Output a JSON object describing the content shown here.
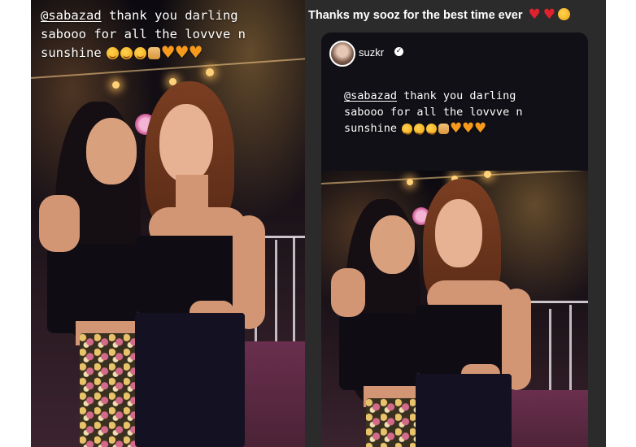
{
  "left_story": {
    "mention": "@sabazad",
    "line1_rest": " thank you darling",
    "line2": "sabooo for all the lovvve n",
    "line3": "sunshine",
    "emojis": [
      "smiling-face-with-hearts",
      "smiling-face-with-hearts",
      "smiling-face-with-hearts",
      "raising-hands",
      "orange-heart",
      "orange-heart",
      "orange-heart"
    ]
  },
  "right_post": {
    "caption": "Thanks my sooz for the best time ever",
    "caption_emojis": [
      "red-heart",
      "red-heart",
      "smiling-face-with-hearts"
    ],
    "shared_story": {
      "username": "suzkr",
      "verified": true,
      "mention": "@sabazad",
      "line1_rest": " thank you darling",
      "line2": "sabooo for all the lovvve n",
      "line3": "sunshine",
      "emojis": [
        "smiling-face-with-hearts",
        "smiling-face-with-hearts",
        "smiling-face-with-hearts",
        "raising-hands",
        "orange-heart",
        "orange-heart",
        "orange-heart"
      ]
    }
  },
  "colors": {
    "heart_red": "#e0222e",
    "heart_orange": "#f59a1c",
    "right_background": "#2b2b2b"
  }
}
